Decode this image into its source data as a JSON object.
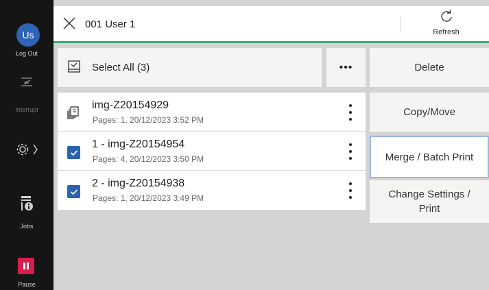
{
  "sidebar": {
    "avatar_initials": "Us",
    "logout_label": "Log Out",
    "interrupt_label": "Interrupt",
    "jobs_label": "Jobs",
    "pause_label": "Pause"
  },
  "header": {
    "title": "001 User 1",
    "refresh_label": "Refresh"
  },
  "selection": {
    "select_all_label": "Select All (3)"
  },
  "files": [
    {
      "name": "img-Z20154929",
      "details": "Pages: 1, 20/12/2023 3:52 PM",
      "checked": false
    },
    {
      "name": "1 - img-Z20154954",
      "details": "Pages: 4, 20/12/2023 3:50 PM",
      "checked": true
    },
    {
      "name": "2 - img-Z20154938",
      "details": "Pages: 1, 20/12/2023 3:49 PM",
      "checked": true
    }
  ],
  "actions": {
    "delete": "Delete",
    "copy_move": "Copy/Move",
    "merge_batch_print": "Merge / Batch Print",
    "change_settings_line1": "Change Settings /",
    "change_settings_line2": "Print"
  },
  "colors": {
    "accent_green": "#3aa779",
    "checkbox_blue": "#2a61b0",
    "avatar_blue": "#2f63b5",
    "pause_red": "#d81e4c"
  }
}
